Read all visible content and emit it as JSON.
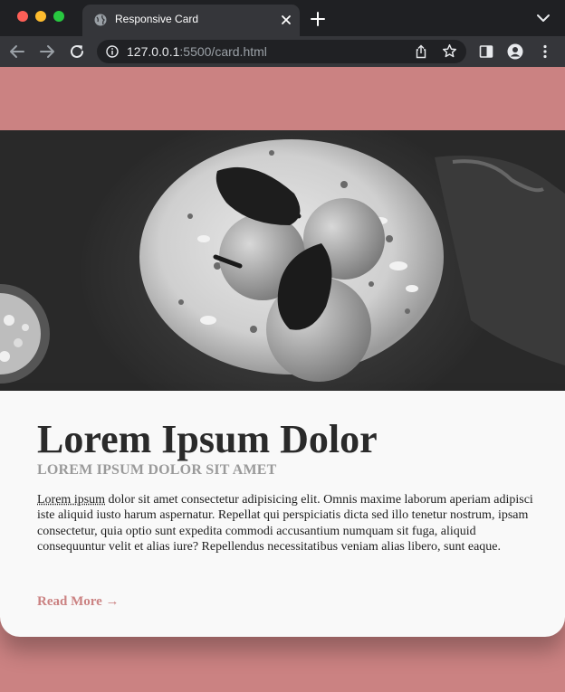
{
  "browser": {
    "tab_title": "Responsive Card",
    "url_host": "127.0.0.1",
    "url_rest": ":5500/card.html"
  },
  "icons": [
    "close-icon",
    "plus-icon",
    "chevron-down-icon",
    "arrow-left-icon",
    "arrow-right-icon",
    "reload-icon",
    "info-icon",
    "share-icon",
    "star-icon",
    "side-panel-icon",
    "profile-icon",
    "more-vert-icon"
  ],
  "colors": {
    "page_background": "#cb8282",
    "accent": "#cb8282",
    "card_background": "#f9f9f9",
    "title": "#2a2a2a",
    "subtitle": "#9a9a9a"
  },
  "card": {
    "title": "Lorem Ipsum Dolor",
    "subtitle": "LOREM IPSUM DOLOR SIT AMET",
    "body_abbr": "Lorem ipsum",
    "body_text": " dolor sit amet consectetur adipisicing elit. Omnis maxime laborum aperiam adipisci iste aliquid iusto harum aspernatur. Repellat qui perspiciatis dicta sed illo tenetur nostrum, ipsam consectetur, quia optio sunt expedita commodi accusantium numquam sit fuga, aliquid consequuntur velit et alias iure? Repellendus necessitatibus veniam alias libero, sunt eaque.",
    "read_more": "Read More →"
  }
}
